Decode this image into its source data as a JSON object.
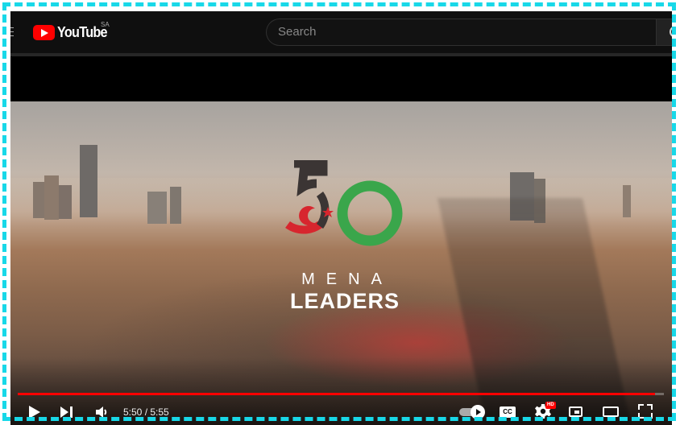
{
  "masthead": {
    "logo_text": "YouTube",
    "country_code": "SA",
    "search_placeholder": "Search"
  },
  "video": {
    "logo_number": "50",
    "title_line1": "MENA",
    "title_line2": "LEADERS"
  },
  "player": {
    "progress_fraction": 0.986,
    "current_time": "5:50",
    "duration": "5:55",
    "time_display": "5:50 / 5:55",
    "settings_badge": "HD",
    "cc_label": "CC",
    "accent_color": "#ff0000",
    "logo_green": "#3aa64b",
    "logo_red": "#d7262e"
  }
}
